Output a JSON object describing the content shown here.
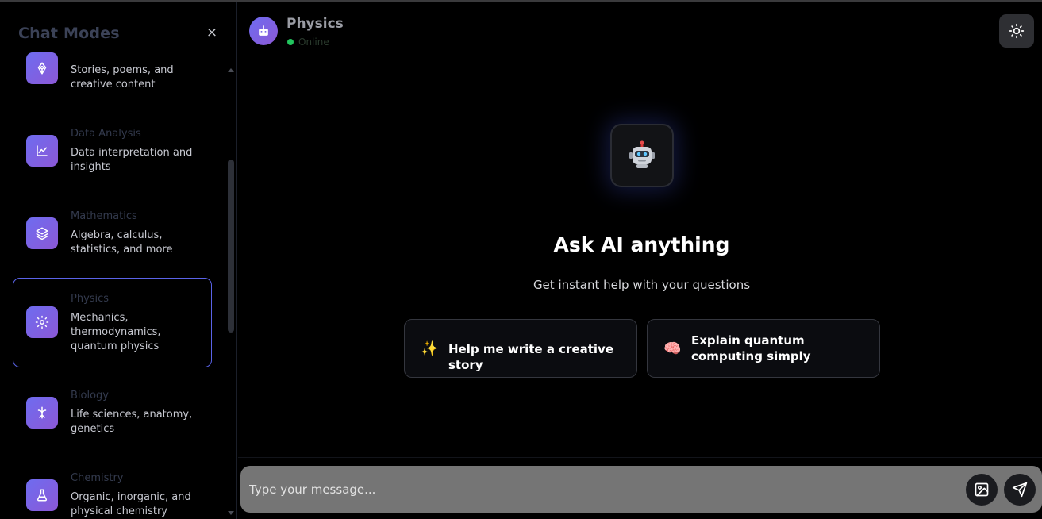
{
  "sidebar": {
    "title": "Chat Modes",
    "close_icon": "×",
    "modes": [
      {
        "name": "",
        "desc": "Stories, poems, and creative content",
        "icon": "pen-nib-icon"
      },
      {
        "name": "Data Analysis",
        "desc": "Data interpretation and insights",
        "icon": "line-chart-icon"
      },
      {
        "name": "Mathematics",
        "desc": "Algebra, calculus, statistics, and more",
        "icon": "layers-icon"
      },
      {
        "name": "Physics",
        "desc": "Mechanics, thermodynamics, quantum physics",
        "icon": "atom-sun-icon",
        "active": true
      },
      {
        "name": "Biology",
        "desc": "Life sciences, anatomy, genetics",
        "icon": "dna-icon"
      },
      {
        "name": "Chemistry",
        "desc": "Organic, inorganic, and physical chemistry",
        "icon": "flask-icon"
      }
    ]
  },
  "header": {
    "title": "Physics",
    "status": "Online",
    "status_color": "#22c55e"
  },
  "main": {
    "hero_title": "Ask AI anything",
    "hero_subtitle": "Get instant help with your questions",
    "suggestions": [
      {
        "emoji": "✨",
        "text": "Help me write a creative story"
      },
      {
        "emoji": "🧠",
        "text": "Explain quantum computing simply"
      }
    ]
  },
  "composer": {
    "placeholder": "Type your message..."
  },
  "colors": {
    "accent": "#6e6cf0",
    "active_border": "#5a63e8"
  }
}
